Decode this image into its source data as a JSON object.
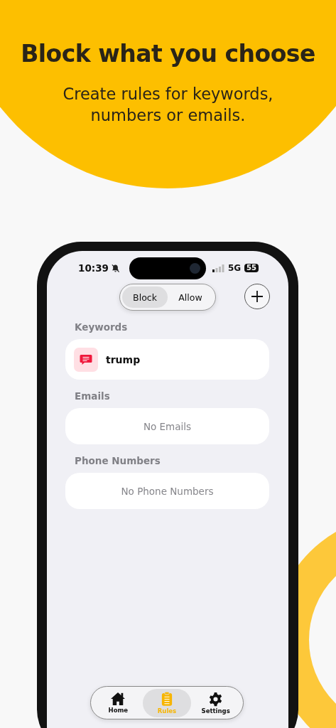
{
  "headline": "Block what you choose",
  "subtitle": "Create rules for keywords, numbers or emails.",
  "status_bar": {
    "time": "10:39",
    "network": "5G",
    "battery": "55"
  },
  "segments": [
    {
      "label": "Block",
      "selected": true
    },
    {
      "label": "Allow",
      "selected": false
    }
  ],
  "sections": [
    {
      "title": "Keywords",
      "items": [
        {
          "text": "trump"
        }
      ]
    },
    {
      "title": "Emails",
      "empty_text": "No Emails"
    },
    {
      "title": "Phone Numbers",
      "empty_text": "No Phone Numbers"
    }
  ],
  "tab_bar": [
    {
      "kind": "home",
      "label": "Home",
      "selected": false
    },
    {
      "kind": "rules",
      "label": "Rules",
      "selected": true
    },
    {
      "kind": "settings",
      "label": "Settings",
      "selected": false
    }
  ]
}
